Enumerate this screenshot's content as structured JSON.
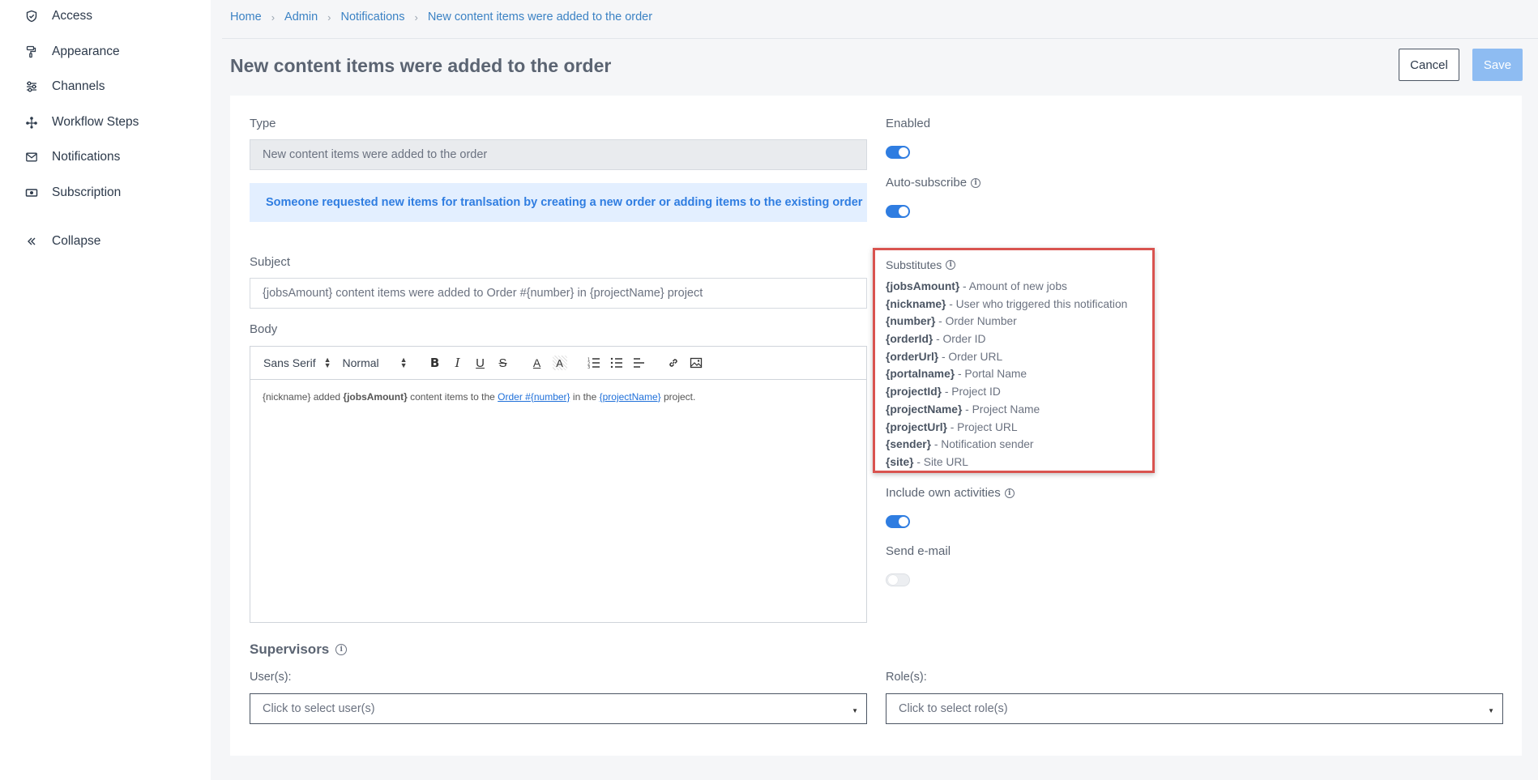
{
  "sidebar": {
    "items": [
      {
        "label": "Access",
        "icon": "shield-icon"
      },
      {
        "label": "Appearance",
        "icon": "paint-roller-icon"
      },
      {
        "label": "Channels",
        "icon": "channels-icon"
      },
      {
        "label": "Workflow Steps",
        "icon": "workflow-icon"
      },
      {
        "label": "Notifications",
        "icon": "envelope-icon"
      },
      {
        "label": "Subscription",
        "icon": "money-icon"
      }
    ],
    "collapse_label": "Collapse"
  },
  "breadcrumb": [
    "Home",
    "Admin",
    "Notifications",
    "New content items were added to the order"
  ],
  "page": {
    "title": "New content items were added to the order",
    "cancel_label": "Cancel",
    "save_label": "Save"
  },
  "form": {
    "type_label": "Type",
    "type_value": "New content items were added to the order",
    "info_text": "Someone requested new items for tranlsation by creating a new order or adding items to the existing order",
    "subject_label": "Subject",
    "subject_value": "{jobsAmount} content items were added to Order #{number} in {projectName} project",
    "body_label": "Body",
    "toolbar": {
      "font": "Sans Serif",
      "size": "Normal"
    },
    "body": {
      "t1": "{nickname} added ",
      "b1": "{jobsAmount}",
      "t2": " content items to the ",
      "link1": "Order #{number}",
      "t3": " in the ",
      "link2": "{projectName}",
      "t4": " project."
    }
  },
  "settings": {
    "enabled_label": "Enabled",
    "enabled": true,
    "auto_subscribe_label": "Auto-subscribe",
    "auto_subscribe": true,
    "include_own_label": "Include own activities",
    "include_own": true,
    "send_email_label": "Send e-mail",
    "send_email": false
  },
  "substitutes": {
    "title": "Substitutes",
    "items": [
      {
        "key": "{jobsAmount}",
        "desc": " - Amount of new jobs"
      },
      {
        "key": "{nickname}",
        "desc": " - User who triggered this notification"
      },
      {
        "key": "{number}",
        "desc": " - Order Number"
      },
      {
        "key": "{orderId}",
        "desc": " - Order ID"
      },
      {
        "key": "{orderUrl}",
        "desc": " - Order URL"
      },
      {
        "key": "{portalname}",
        "desc": " - Portal Name"
      },
      {
        "key": "{projectId}",
        "desc": " - Project ID"
      },
      {
        "key": "{projectName}",
        "desc": " - Project Name"
      },
      {
        "key": "{projectUrl}",
        "desc": " - Project URL"
      },
      {
        "key": "{sender}",
        "desc": " - Notification sender"
      },
      {
        "key": "{site}",
        "desc": " - Site URL"
      }
    ]
  },
  "supervisors": {
    "title": "Supervisors",
    "users_label": "User(s):",
    "users_placeholder": "Click to select user(s)",
    "roles_label": "Role(s):",
    "roles_placeholder": "Click to select role(s)"
  },
  "colors": {
    "accent": "#2f7de1",
    "highlight_border": "#d9534f",
    "save_disabled": "#8ebcf2"
  }
}
